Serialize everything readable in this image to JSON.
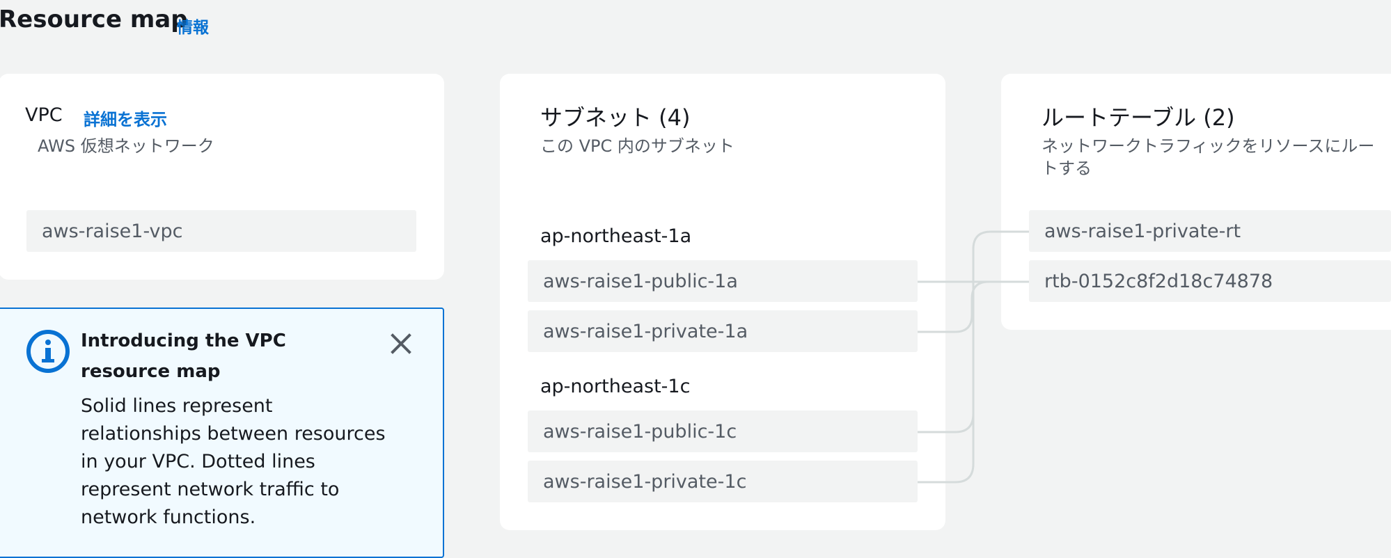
{
  "header": {
    "title": "Resource map",
    "info_link": "情報"
  },
  "vpc_card": {
    "title": "VPC",
    "details_link": "詳細を表示",
    "subtitle": "AWS 仮想ネットワーク",
    "vpc_name": "aws-raise1-vpc"
  },
  "alert": {
    "title": "Introducing the VPC resource map",
    "body": "Solid lines represent relationships between resources in your VPC. Dotted lines represent network traffic to network functions.",
    "icon": "info-icon",
    "close_icon": "close-icon"
  },
  "subnets_card": {
    "title": "サブネット (4)",
    "subtitle": "この VPC 内のサブネット",
    "zones": [
      {
        "name": "ap-northeast-1a",
        "subnets": [
          "aws-raise1-public-1a",
          "aws-raise1-private-1a"
        ]
      },
      {
        "name": "ap-northeast-1c",
        "subnets": [
          "aws-raise1-public-1c",
          "aws-raise1-private-1c"
        ]
      }
    ]
  },
  "route_tables_card": {
    "title": "ルートテーブル (2)",
    "subtitle": "ネットワークトラフィックをリソースにルートする",
    "items": [
      "aws-raise1-private-rt",
      "rtb-0152c8f2d18c74878"
    ]
  },
  "colors": {
    "accent": "#0972d3",
    "connector": "#d5dbdb",
    "background": "#f2f3f3"
  }
}
